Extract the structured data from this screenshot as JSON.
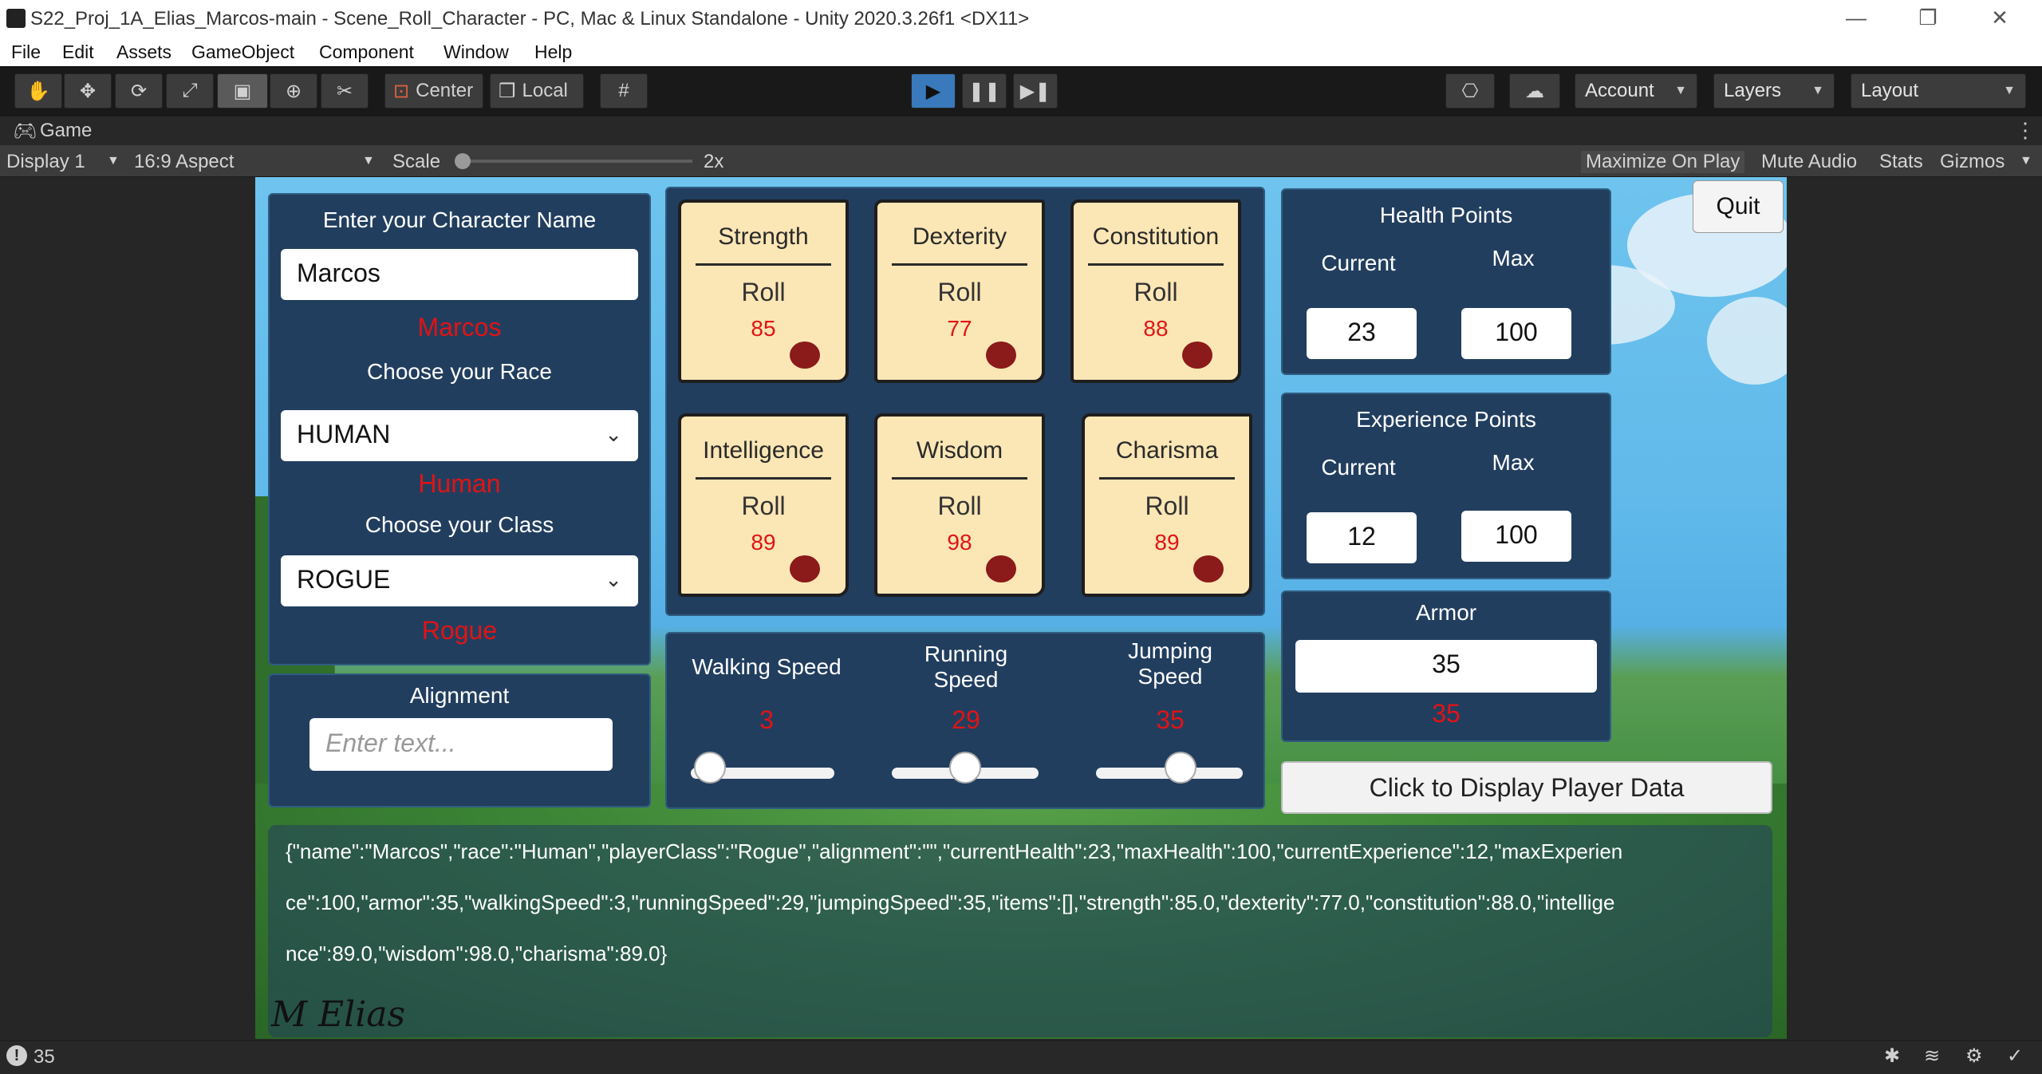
{
  "window": {
    "title": "S22_Proj_1A_Elias_Marcos-main - Scene_Roll_Character - PC, Mac & Linux Standalone - Unity 2020.3.26f1 <DX11>",
    "minimize": "—",
    "restore": "❐",
    "close": "✕"
  },
  "menu": [
    "File",
    "Edit",
    "Assets",
    "GameObject",
    "Component",
    "Window",
    "Help"
  ],
  "toolbar": {
    "pivot_center": "Center",
    "pivot_local": "Local",
    "account": "Account",
    "layers": "Layers",
    "layout": "Layout"
  },
  "game_tab": {
    "label": "Game"
  },
  "game_bar": {
    "display": "Display 1",
    "aspect": "16:9 Aspect",
    "scale_label": "Scale",
    "scale_value": "2x",
    "maximize": "Maximize On Play",
    "mute": "Mute Audio",
    "stats": "Stats",
    "gizmos": "Gizmos"
  },
  "status": {
    "warning_count": "35"
  },
  "game": {
    "name_panel": {
      "heading": "Enter your Character Name",
      "name_value": "Marcos",
      "name_echo": "Marcos",
      "race_heading": "Choose your Race",
      "race_value": "HUMAN",
      "race_echo": "Human",
      "class_heading": "Choose your Class",
      "class_value": "ROGUE",
      "class_echo": "Rogue"
    },
    "alignment": {
      "heading": "Alignment",
      "placeholder": "Enter text..."
    },
    "stats": [
      {
        "name": "Strength",
        "roll": "Roll",
        "value": "85"
      },
      {
        "name": "Dexterity",
        "roll": "Roll",
        "value": "77"
      },
      {
        "name": "Constitution",
        "roll": "Roll",
        "value": "88"
      },
      {
        "name": "Intelligence",
        "roll": "Roll",
        "value": "89"
      },
      {
        "name": "Wisdom",
        "roll": "Roll",
        "value": "98"
      },
      {
        "name": "Charisma",
        "roll": "Roll",
        "value": "89"
      }
    ],
    "speeds": {
      "walking_label": "Walking Speed",
      "walking_value": "3",
      "walking_level": 0.03,
      "running_label_1": "Running",
      "running_label_2": "Speed",
      "running_value": "29",
      "running_level": 0.5,
      "jumping_label_1": "Jumping",
      "jumping_label_2": "Speed",
      "jumping_value": "35",
      "jumping_level": 0.6
    },
    "health": {
      "heading": "Health Points",
      "current_label": "Current",
      "max_label": "Max",
      "current": "23",
      "max": "100"
    },
    "experience": {
      "heading": "Experience Points",
      "current_label": "Current",
      "max_label": "Max",
      "current": "12",
      "max": "100"
    },
    "armor": {
      "heading": "Armor",
      "value": "35",
      "echo": "35"
    },
    "quit": "Quit",
    "display_button": "Click to Display Player Data",
    "json_line1": "{\"name\":\"Marcos\",\"race\":\"Human\",\"playerClass\":\"Rogue\",\"alignment\":\"\",\"currentHealth\":23,\"maxHealth\":100,\"currentExperience\":12,\"maxExperien",
    "json_line2": "ce\":100,\"armor\":35,\"walkingSpeed\":3,\"runningSpeed\":29,\"jumpingSpeed\":35,\"items\":[],\"strength\":85.0,\"dexterity\":77.0,\"constitution\":88.0,\"intellige",
    "json_line3": "nce\":89.0,\"wisdom\":98.0,\"charisma\":89.0}",
    "signature": "M Elias"
  }
}
